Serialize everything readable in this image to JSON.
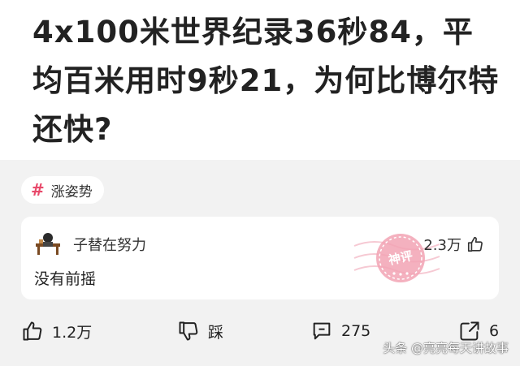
{
  "post": {
    "title": "4x100米世界纪录36秒84，平均百米用时9秒21，为何比博尔特还快?"
  },
  "tag": {
    "symbol": "#",
    "label": "涨姿势"
  },
  "comment": {
    "username": "子替在努力",
    "likes": "2.3万",
    "text": "没有前摇",
    "stamp_text": "神评"
  },
  "actions": {
    "like_count": "1.2万",
    "dislike_label": "踩",
    "comment_count": "275",
    "share_count": "6"
  },
  "watermark": "头条 @亮亮每天讲故事",
  "colors": {
    "accent": "#e84a6b",
    "stamp": "#f2a3b4"
  }
}
